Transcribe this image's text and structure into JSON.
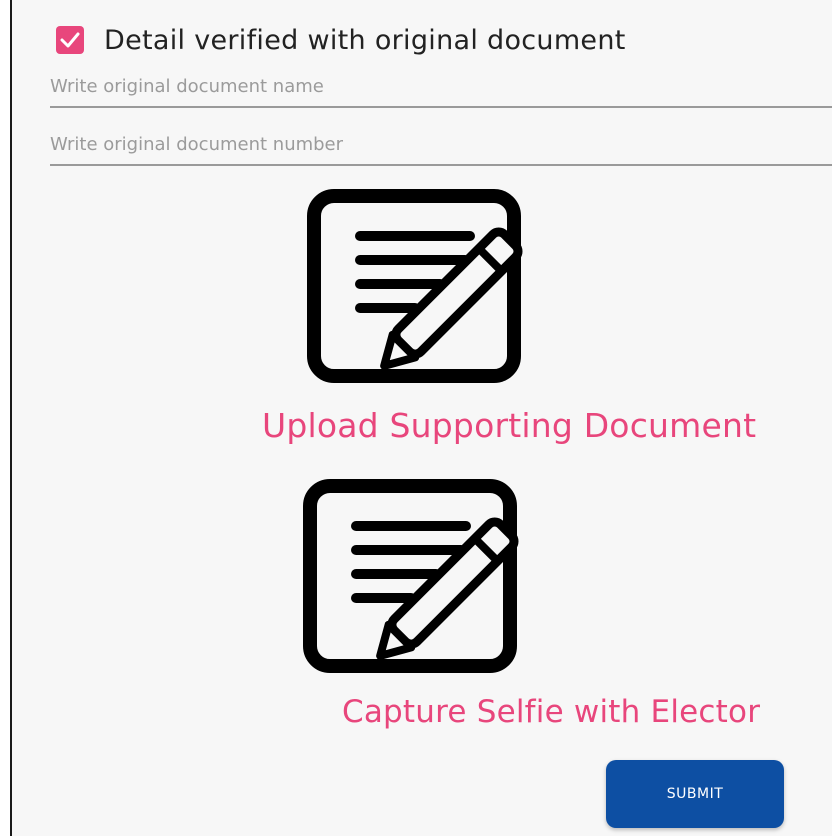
{
  "colors": {
    "accent": "#e8467c",
    "primary_button": "#0d4fa3",
    "background": "#f7f7f7"
  },
  "verification": {
    "checked": true,
    "label": "Detail verified with original document"
  },
  "document_name_field": {
    "value": "",
    "placeholder": "Write original document name"
  },
  "document_number_field": {
    "value": "",
    "placeholder": "Write original document number"
  },
  "upload_document": {
    "icon": "document-edit-icon",
    "label": "Upload Supporting Document"
  },
  "capture_selfie": {
    "icon": "document-edit-icon",
    "label": "Capture Selfie with Elector"
  },
  "submit": {
    "label": "SUBMIT"
  }
}
